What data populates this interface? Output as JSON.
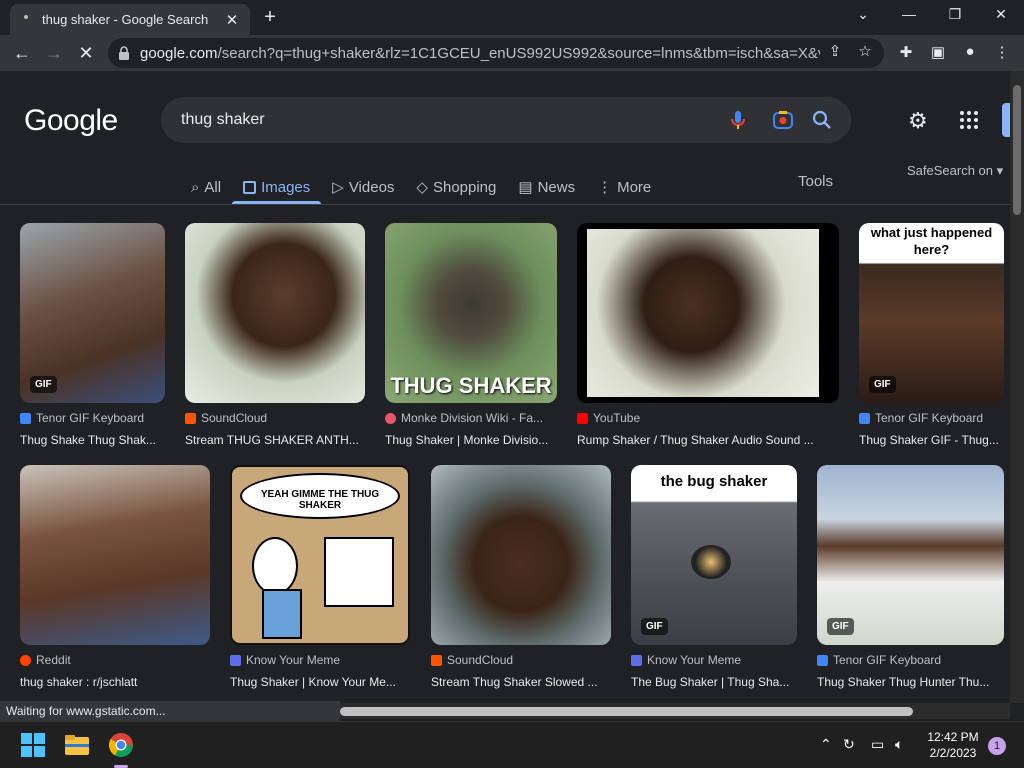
{
  "browser": {
    "tab_title": "thug shaker - Google Search",
    "tab_close": "✕",
    "new_tab": "+",
    "url_host": "google.com",
    "url_rest": "/search?q=thug+shaker&rlz=1C1GCEU_enUS992US992&source=lnms&tbm=isch&sa=X&ved=..."
  },
  "google": {
    "logo": "Google",
    "query": "thug shaker",
    "tabs": [
      {
        "label": "All",
        "icon": "search-icon"
      },
      {
        "label": "Images",
        "icon": "image-icon",
        "active": true
      },
      {
        "label": "Videos",
        "icon": "play-icon"
      },
      {
        "label": "Shopping",
        "icon": "tag-icon"
      },
      {
        "label": "News",
        "icon": "news-icon"
      },
      {
        "label": "More",
        "icon": "more-vert-icon"
      }
    ],
    "tools": "Tools",
    "safesearch": "SafeSearch on"
  },
  "results": [
    {
      "source": "Tenor GIF Keyboard",
      "title": "Thug Shake Thug Shak...",
      "gif": "GIF",
      "fav": "#4285f4"
    },
    {
      "source": "SoundCloud",
      "title": "Stream THUG SHAKER ANTH...",
      "fav": "#ff5500"
    },
    {
      "source": "Monke Division Wiki - Fa...",
      "title": "Thug Shaker | Monke Divisio...",
      "overlay": "THUG SHAKER",
      "fav": "#e8546b"
    },
    {
      "source": "YouTube",
      "title": "Rump Shaker / Thug Shaker Audio Sound ...",
      "fav": "#ff0000"
    },
    {
      "source": "Tenor GIF Keyboard",
      "title": "Thug Shaker GIF - Thug...",
      "gif": "GIF",
      "caption": "what just happened here?",
      "fav": "#4285f4"
    },
    {
      "source": "Reddit",
      "title": "thug shaker : r/jschlatt",
      "fav": "#ff4500"
    },
    {
      "source": "Know Your Meme",
      "title": "Thug Shaker | Know Your Me...",
      "caption": "YEAH GIMME THE THUG SHAKER",
      "fav": "#5f6ee8"
    },
    {
      "source": "SoundCloud",
      "title": "Stream Thug Shaker Slowed ...",
      "fav": "#ff5500"
    },
    {
      "source": "Know Your Meme",
      "title": "The Bug Shaker | Thug Sha...",
      "gif": "GIF",
      "caption": "the bug shaker",
      "fav": "#5f6ee8"
    },
    {
      "source": "Tenor GIF Keyboard",
      "title": "Thug Shaker Thug Hunter Thu...",
      "gif": "GIF",
      "fav": "#4285f4"
    }
  ],
  "status": "Waiting for www.gstatic.com...",
  "taskbar": {
    "time": "12:42 PM",
    "date": "2/2/2023",
    "notifications": "1"
  }
}
